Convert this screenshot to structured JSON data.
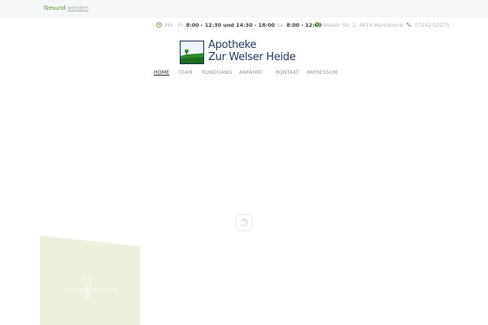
{
  "topbar": {
    "text_green": "Gesund",
    "text_link": "werden"
  },
  "contact": {
    "hours_prefix": "Mo - Fr:",
    "hours_weekdays": "8:00 - 12:30 und 14:30 - 18:00",
    "hours_sat_prefix": "Sa:",
    "hours_saturday": "8:00 - 12:00",
    "address": "Welser Str. 2, 4614 Marchtrenk",
    "phone": "07242/52275"
  },
  "logo": {
    "line1": "Apotheke",
    "line2": "Zur Welser Heide"
  },
  "nav": {
    "items": [
      "HOME",
      "TEAM",
      "RUNDGANG",
      "ANFAHRT",
      "KONTAKT",
      "IMPRESSUM"
    ],
    "active_index": 0
  },
  "card": {
    "title": "Gesund werden"
  },
  "colors": {
    "accent_green": "#4f9d2f",
    "brand_navy": "#1f3b61",
    "card_background": "#ecf0dd"
  }
}
